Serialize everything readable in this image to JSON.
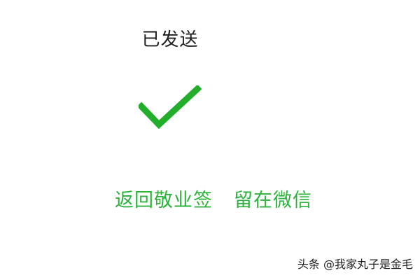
{
  "dialog": {
    "title": "已发送",
    "status_icon": "check-icon",
    "actions": [
      {
        "label": "返回敬业签"
      },
      {
        "label": "留在微信"
      }
    ]
  },
  "watermark": {
    "text": "头条 @我家丸子是金毛"
  },
  "colors": {
    "accent": "#2cb23b",
    "title": "#1f1f1f",
    "background": "#ffffff"
  }
}
